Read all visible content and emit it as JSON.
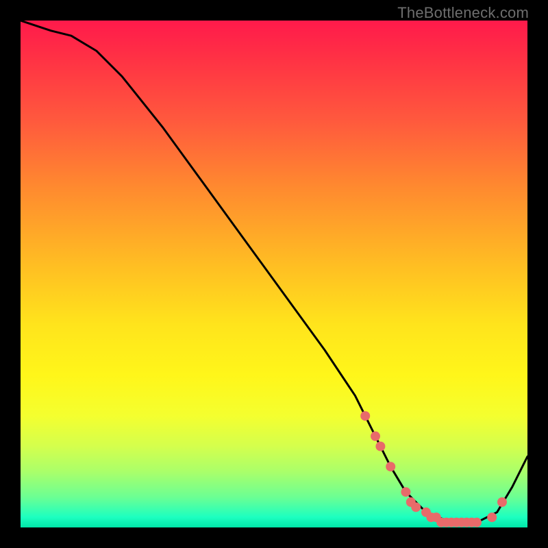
{
  "watermark": "TheBottleneck.com",
  "colors": {
    "background": "#000000",
    "curve_stroke": "#000000",
    "marker_fill": "#e86a6a",
    "gradient_top": "#ff1a4b",
    "gradient_bottom": "#00e6a8"
  },
  "chart_data": {
    "type": "line",
    "title": "",
    "xlabel": "",
    "ylabel": "",
    "xlim": [
      0,
      100
    ],
    "ylim": [
      0,
      100
    ],
    "grid": false,
    "legend": false,
    "series": [
      {
        "name": "bottleneck-curve",
        "x": [
          0,
          3,
          6,
          10,
          15,
          20,
          28,
          36,
          44,
          52,
          60,
          66,
          70,
          73,
          76,
          80,
          85,
          90,
          94,
          97,
          100
        ],
        "values": [
          100,
          99,
          98,
          97,
          94,
          89,
          79,
          68,
          57,
          46,
          35,
          26,
          18,
          12,
          7,
          3,
          1,
          1,
          3,
          8,
          14
        ]
      }
    ],
    "markers": {
      "name": "optimal-range-points",
      "x": [
        68,
        70,
        71,
        73,
        76,
        77,
        78,
        80,
        81,
        82,
        83,
        84,
        85,
        86,
        87,
        88,
        89,
        90,
        93,
        95
      ],
      "values": [
        22,
        18,
        16,
        12,
        7,
        5,
        4,
        3,
        2,
        2,
        1,
        1,
        1,
        1,
        1,
        1,
        1,
        1,
        2,
        5
      ]
    }
  }
}
